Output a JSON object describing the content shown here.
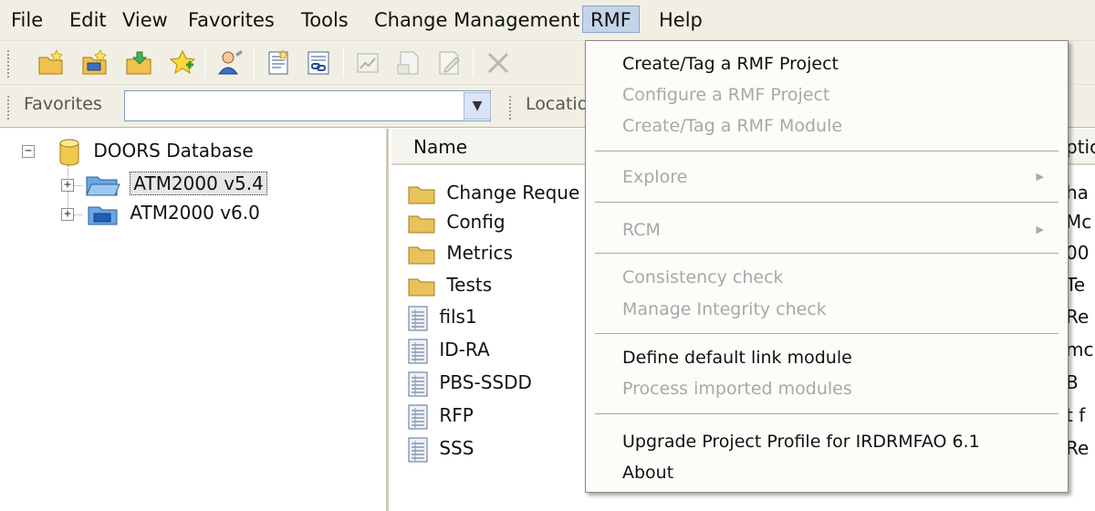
{
  "menubar": {
    "items": [
      "File",
      "Edit",
      "View",
      "Favorites",
      "Tools",
      "Change Management",
      "RMF",
      "Help"
    ]
  },
  "favbar": {
    "favorites_label": "Favorites",
    "favorites_value": "",
    "location_label": "Locatio"
  },
  "tree": {
    "root": "DOORS Database",
    "children": [
      "ATM2000 v5.4",
      "ATM2000 v6.0"
    ]
  },
  "list": {
    "name_header": "Name",
    "description_header": "ptic",
    "items": [
      "Change Reque",
      "Config",
      "Metrics",
      "Tests",
      "fils1",
      "ID-RA",
      "PBS-SSDD",
      "RFP",
      "SSS"
    ],
    "descriptions": [
      "ha",
      "Mc",
      "00",
      "Te",
      "Re",
      "mc",
      "B",
      "t f",
      "Re"
    ]
  },
  "rmf_menu": {
    "create_tag_project": "Create/Tag a RMF Project",
    "configure_project": "Configure a RMF Project",
    "create_tag_module": "Create/Tag a RMF Module",
    "explore": "Explore",
    "rcm": "RCM",
    "consistency_check": "Consistency check",
    "manage_integrity_check": "Manage Integrity check",
    "define_default_link_module": "Define default link module",
    "process_imported_modules": "Process imported modules",
    "upgrade_project_profile": "Upgrade Project Profile for IRDRMFAO 6.1",
    "about": "About"
  },
  "colors": {
    "chrome": "#f1efe4",
    "menu_highlight": "#c5d4e8",
    "folder": "#e8c25a",
    "disabled_text": "#a8a8a8"
  }
}
